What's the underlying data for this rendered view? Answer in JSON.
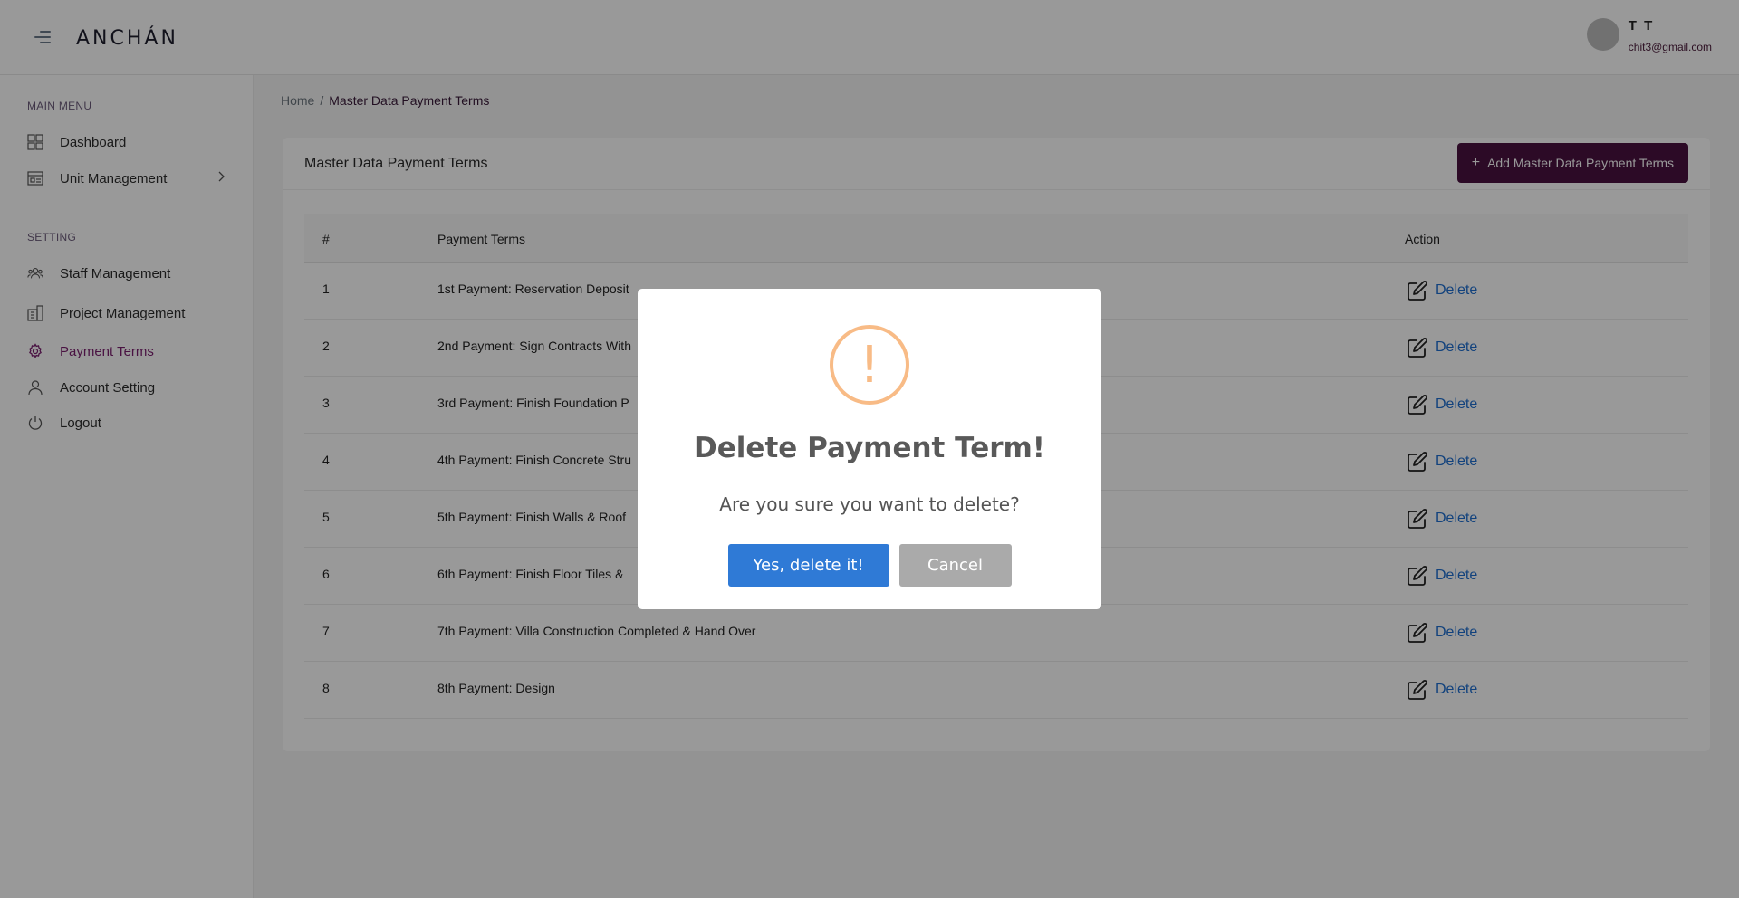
{
  "header": {
    "logo": "ANCHÁN",
    "user_name": "T T",
    "user_email": "chit3@gmail.com"
  },
  "sidebar": {
    "main_menu_title": "MAIN MENU",
    "setting_title": "SETTING",
    "main_items": [
      {
        "label": "Dashboard",
        "icon": "dashboard-icon"
      },
      {
        "label": "Unit Management",
        "icon": "unit-icon"
      }
    ],
    "setting_items": [
      {
        "label": "Staff Management",
        "icon": "staff-icon"
      },
      {
        "label": "Project Management",
        "icon": "building-icon"
      },
      {
        "label": "Payment Terms",
        "icon": "gear-icon",
        "active": true
      },
      {
        "label": "Account Setting",
        "icon": "user-icon"
      },
      {
        "label": "Logout",
        "icon": "power-icon"
      }
    ]
  },
  "breadcrumb": {
    "home": "Home",
    "separator": "/",
    "current": "Master Data Payment Terms"
  },
  "card": {
    "title": "Master Data Payment Terms",
    "add_button": "Add Master Data Payment Terms"
  },
  "table": {
    "headers": {
      "num": "#",
      "term": "Payment Terms",
      "action": "Action"
    },
    "delete_label": "Delete",
    "rows": [
      {
        "num": "1",
        "term": "1st  Payment:  Reservation Deposit"
      },
      {
        "num": "2",
        "term": "2nd Payment: Sign Contracts With"
      },
      {
        "num": "3",
        "term": "3rd Payment: Finish Foundation P"
      },
      {
        "num": "4",
        "term": "4th Payment: Finish Concrete Stru"
      },
      {
        "num": "5",
        "term": "5th Payment: Finish Walls & Roof"
      },
      {
        "num": "6",
        "term": "6th Payment: Finish Floor Tiles &"
      },
      {
        "num": "7",
        "term": "7th Payment: Villa Construction Completed & Hand Over"
      },
      {
        "num": "8",
        "term": "8th Payment: Design"
      }
    ]
  },
  "modal": {
    "icon_symbol": "!",
    "title": "Delete Payment Term!",
    "text": "Are you sure you want to delete?",
    "confirm": "Yes, delete it!",
    "cancel": "Cancel"
  },
  "colors": {
    "brand": "#4a1140",
    "active_nav": "#7b1e6e",
    "link": "#1e6fd0",
    "confirm_button": "#2f7ad6",
    "cancel_button": "#aaaaaa",
    "warning": "#f8bb86"
  }
}
